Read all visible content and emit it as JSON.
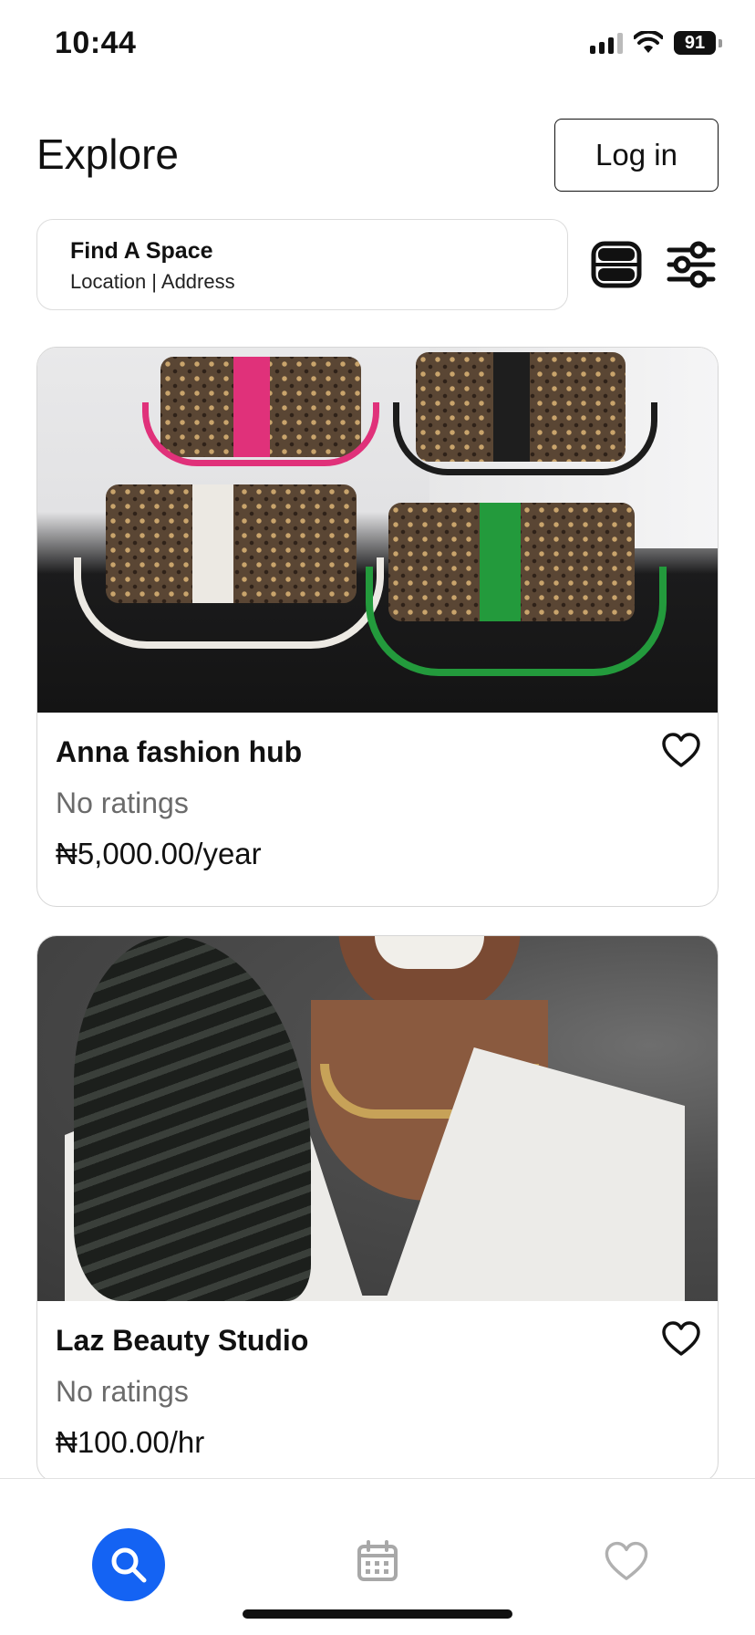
{
  "status_bar": {
    "time": "10:44",
    "battery": "91"
  },
  "header": {
    "title": "Explore",
    "login_label": "Log in"
  },
  "search": {
    "title": "Find A Space",
    "subtitle": "Location | Address"
  },
  "listings": [
    {
      "name": "Anna fashion hub",
      "rating": "No ratings",
      "price": "₦5,000.00/year"
    },
    {
      "name": "Laz Beauty Studio",
      "rating": "No ratings",
      "price": "₦100.00/hr"
    }
  ],
  "icons": {
    "map": "map-icon",
    "filter": "filter-sliders-icon",
    "favorite": "heart-icon",
    "nav_search": "search-icon",
    "nav_bookings": "calendar-icon",
    "nav_favorites": "heart-icon"
  },
  "colors": {
    "accent": "#1463f3",
    "muted_text": "#6b6b6b",
    "border": "#d6d6d6"
  }
}
